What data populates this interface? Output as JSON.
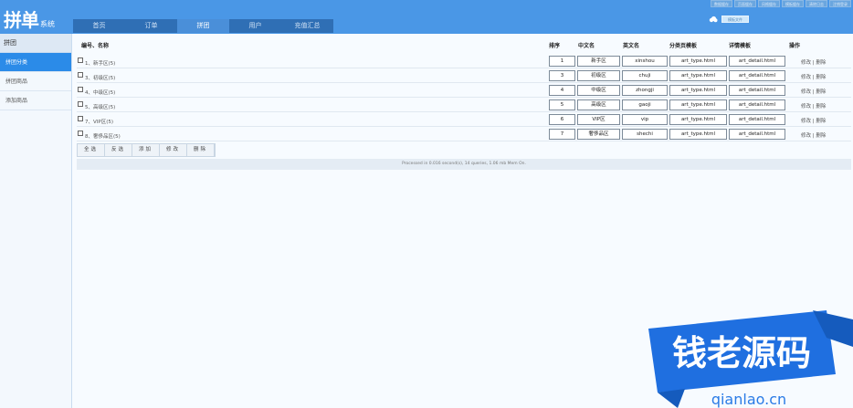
{
  "header": {
    "logo": "拼单",
    "logo_sub": "系统",
    "top_links": [
      "数据缓存",
      "页面缓存",
      "风格缓存",
      "模板缓存",
      "清除日志",
      "注销登录"
    ],
    "open_button": "模板文件",
    "nav_tabs": [
      {
        "label": "首页",
        "active": false
      },
      {
        "label": "订单",
        "active": false
      },
      {
        "label": "拼团",
        "active": true
      },
      {
        "label": "用户",
        "active": false
      },
      {
        "label": "充值汇总",
        "active": false
      }
    ]
  },
  "sidebar": {
    "title": "拼团",
    "items": [
      {
        "label": "拼团分类",
        "active": true
      },
      {
        "label": "拼团商品",
        "active": false
      },
      {
        "label": "添加商品",
        "active": false
      }
    ]
  },
  "table": {
    "headers": {
      "id_name": "编号、名称",
      "order": "排序",
      "cn_name": "中文名",
      "en_name": "英文名",
      "cat_tpl": "分类页模板",
      "detail_tpl": "详情模板",
      "ops": "操作"
    },
    "rows": [
      {
        "label": "1、新手区(5)",
        "order": "1",
        "cn": "新手区",
        "en": "xinshou",
        "cat_tpl": "art_type.html",
        "detail_tpl": "art_detail.html"
      },
      {
        "label": "3、初级区(5)",
        "order": "3",
        "cn": "初级区",
        "en": "chuji",
        "cat_tpl": "art_type.html",
        "detail_tpl": "art_detail.html"
      },
      {
        "label": "4、中级区(5)",
        "order": "4",
        "cn": "中级区",
        "en": "zhongji",
        "cat_tpl": "art_type.html",
        "detail_tpl": "art_detail.html"
      },
      {
        "label": "5、高级区(5)",
        "order": "5",
        "cn": "高级区",
        "en": "gaoji",
        "cat_tpl": "art_type.html",
        "detail_tpl": "art_detail.html"
      },
      {
        "label": "7、VIP区(5)",
        "order": "6",
        "cn": "VIP区",
        "en": "vip",
        "cat_tpl": "art_type.html",
        "detail_tpl": "art_detail.html"
      },
      {
        "label": "8、奢侈品区(5)",
        "order": "7",
        "cn": "奢侈品区",
        "en": "shechi",
        "cat_tpl": "art_type.html",
        "detail_tpl": "art_detail.html"
      }
    ],
    "edit_label": "修改",
    "sep": "|",
    "delete_label": "删除"
  },
  "actions": [
    "全选",
    "反选",
    "添加",
    "修改",
    "删除"
  ],
  "footer": "Processed in 0.016 second(s), 14 queries, 1.06 mb Mem On.",
  "watermark": {
    "brand": "钱老源码",
    "url": "qianlao.cn"
  },
  "colors": {
    "header": "#4a97e6",
    "nav": "#2f6fb5",
    "sidebar_active": "#2b8be8",
    "watermark_blue": "#1f6fe0"
  }
}
